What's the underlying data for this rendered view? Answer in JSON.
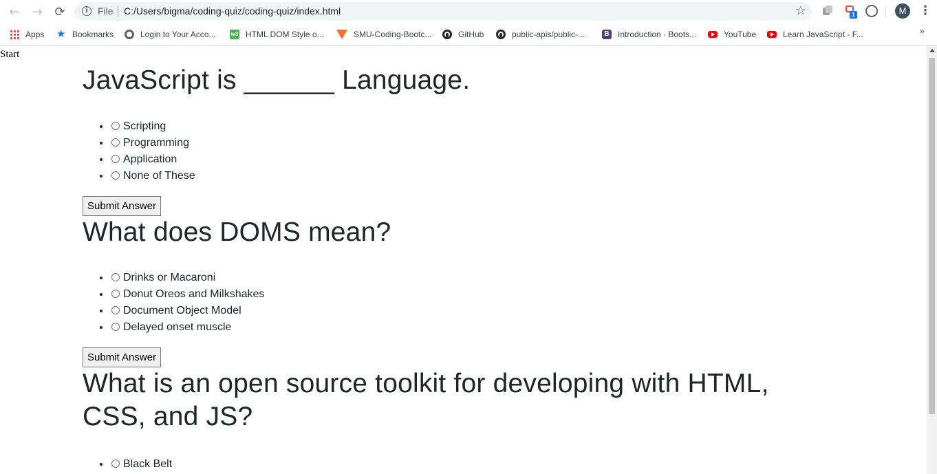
{
  "browser": {
    "nav": {
      "back": "←",
      "forward": "→",
      "reload": "⟳"
    },
    "omnibox": {
      "scheme_label": "File",
      "url": "C:/Users/bigma/coding-quiz/coding-quiz/index.html"
    },
    "profile_initial": "M",
    "extension_badge": "1"
  },
  "bookmarks": [
    {
      "label": "Apps",
      "icon": "apps-grid-icon"
    },
    {
      "label": "Bookmarks",
      "icon": "star-icon"
    },
    {
      "label": "Login to Your Acco...",
      "icon": "globe-icon"
    },
    {
      "label": "HTML DOM Style o...",
      "icon": "w3schools-icon"
    },
    {
      "label": "SMU-Coding-Bootc...",
      "icon": "gitlab-icon"
    },
    {
      "label": "GitHub",
      "icon": "github-icon"
    },
    {
      "label": "public-apis/public-...",
      "icon": "github-icon"
    },
    {
      "label": "Introduction · Boots...",
      "icon": "bootstrap-icon"
    },
    {
      "label": "YouTube",
      "icon": "youtube-icon"
    },
    {
      "label": "Learn JavaScript - F...",
      "icon": "youtube-icon"
    }
  ],
  "page": {
    "start_label": "Start",
    "questions": [
      {
        "title": "JavaScript is ______ Language.",
        "answers": [
          "Scripting",
          "Programming",
          "Application",
          "None of These"
        ],
        "submit_label": "Submit Answer"
      },
      {
        "title": "What does DOMS mean?",
        "answers": [
          "Drinks or Macaroni",
          "Donut Oreos and Milkshakes",
          "Document Object Model",
          "Delayed onset muscle"
        ],
        "submit_label": "Submit Answer"
      },
      {
        "title": "What is an open source toolkit for developing with HTML, CSS, and JS?",
        "answers": [
          "Black Belt"
        ]
      }
    ]
  }
}
